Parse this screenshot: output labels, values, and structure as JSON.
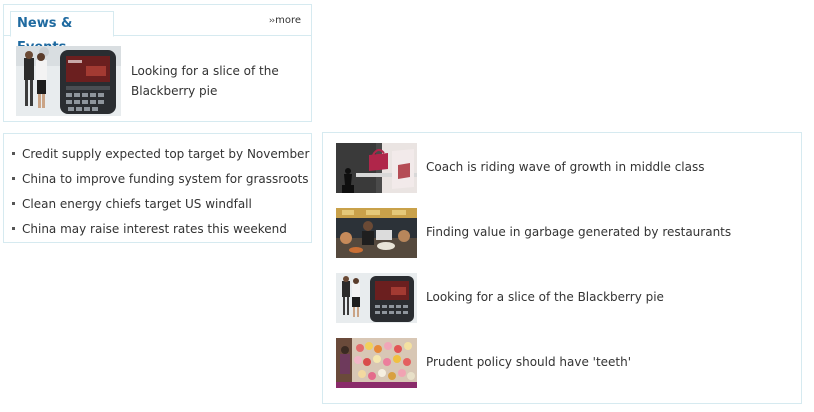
{
  "news_panel": {
    "tab_label": "News & Events",
    "more_label": "more",
    "feature": {
      "title": "Looking for a slice of the Blackberry pie"
    }
  },
  "headlines": [
    "Credit supply expected top target by November",
    "China to improve funding system for grassroots",
    "Clean energy chiefs target US windfall",
    "China may raise interest rates this weekend"
  ],
  "stories": [
    {
      "title": "Coach is riding wave of growth in middle class"
    },
    {
      "title": "Finding value in garbage generated by restaurants"
    },
    {
      "title": "Looking for a slice of the Blackberry pie"
    },
    {
      "title": "Prudent policy should have 'teeth'"
    }
  ],
  "colors": {
    "border": "#d6eaf0",
    "tab_text": "#1f6aa0",
    "text": "#333333"
  }
}
